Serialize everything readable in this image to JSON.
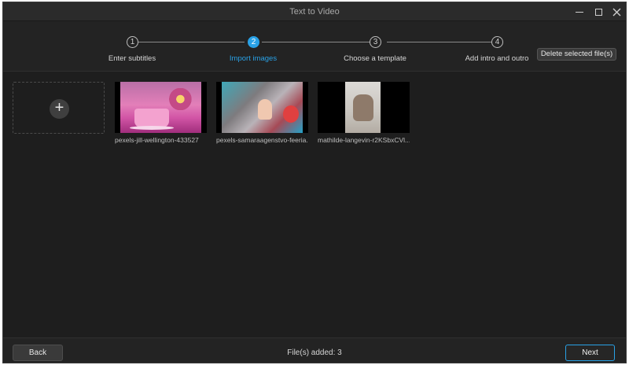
{
  "window": {
    "title": "Text to Video",
    "controls": [
      "minimize-icon",
      "maximize-icon",
      "close-icon"
    ]
  },
  "stepper": {
    "steps": [
      {
        "number": "1",
        "label": "Enter subtitles",
        "active": false
      },
      {
        "number": "2",
        "label": "Import images",
        "active": true
      },
      {
        "number": "3",
        "label": "Choose a template",
        "active": false
      },
      {
        "number": "4",
        "label": "Add intro and outro",
        "active": false
      }
    ],
    "accent_color": "#29a1e6"
  },
  "toolbar": {
    "delete_label": "Delete selected file(s)"
  },
  "images": [
    {
      "caption": "pexels-jill-wellington-433527"
    },
    {
      "caption": "pexels-samaraagenstvo-feeria..."
    },
    {
      "caption": "mathilde-langevin-r2KSbxCVl..."
    }
  ],
  "add_tile": {
    "icon": "plus-icon"
  },
  "footer": {
    "back_label": "Back",
    "files_added": "File(s) added: 3",
    "next_label": "Next"
  }
}
